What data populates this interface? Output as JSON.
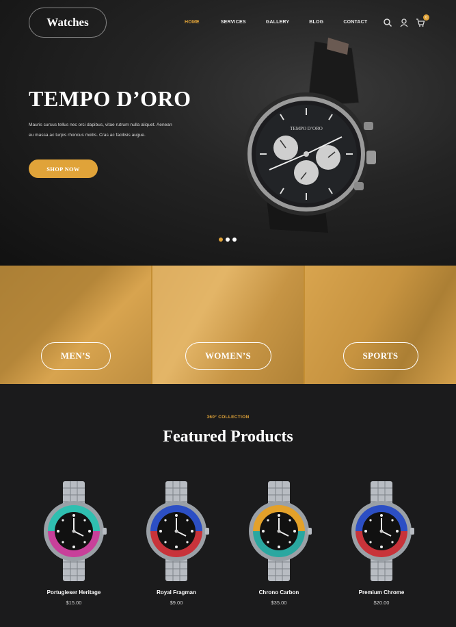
{
  "brand": {
    "logo_text": "Watches"
  },
  "nav": {
    "items": [
      {
        "label": "HOME",
        "active": true
      },
      {
        "label": "SERVICES",
        "active": false
      },
      {
        "label": "GALLERY",
        "active": false
      },
      {
        "label": "BLOG",
        "active": false
      },
      {
        "label": "CONTACT",
        "active": false
      }
    ],
    "icons": [
      "search-icon",
      "user-icon",
      "cart-icon"
    ],
    "cart_count": "0"
  },
  "hero": {
    "title": "TEMPO D’ORO",
    "description_line1": "Mauris cursus tellus nec orci dapibus, vitae rutrum nulla aliquet. Aenean",
    "description_line2": "eu massa ac turpis rhoncus mollis. Cras ac facilisis augue.",
    "cta_label": "SHOP NOW",
    "watch_dial_text": "TEMPO D’ORO",
    "slides": 3,
    "active_slide": 0
  },
  "categories": [
    {
      "label": "MEN’S"
    },
    {
      "label": "WOMEN’S"
    },
    {
      "label": "SPORTS"
    }
  ],
  "featured": {
    "kicker": "360° COLLECTION",
    "title": "Featured Products",
    "products": [
      {
        "name": "Portugieser Heritage",
        "price": "$15.00",
        "bezel_top": "#2fbfb0",
        "bezel_bottom": "#c8409a"
      },
      {
        "name": "Royal Fragman",
        "price": "$9.00",
        "bezel_top": "#2c4fc4",
        "bezel_bottom": "#c8333a"
      },
      {
        "name": "Chrono Carbon",
        "price": "$35.00",
        "bezel_top": "#e3a12a",
        "bezel_bottom": "#2aa7a0"
      },
      {
        "name": "Premium Chrome",
        "price": "$20.00",
        "bezel_top": "#2c4fc4",
        "bezel_bottom": "#c8333a"
      }
    ]
  },
  "colors": {
    "accent": "#e0a339",
    "background": "#1b1b1c"
  }
}
